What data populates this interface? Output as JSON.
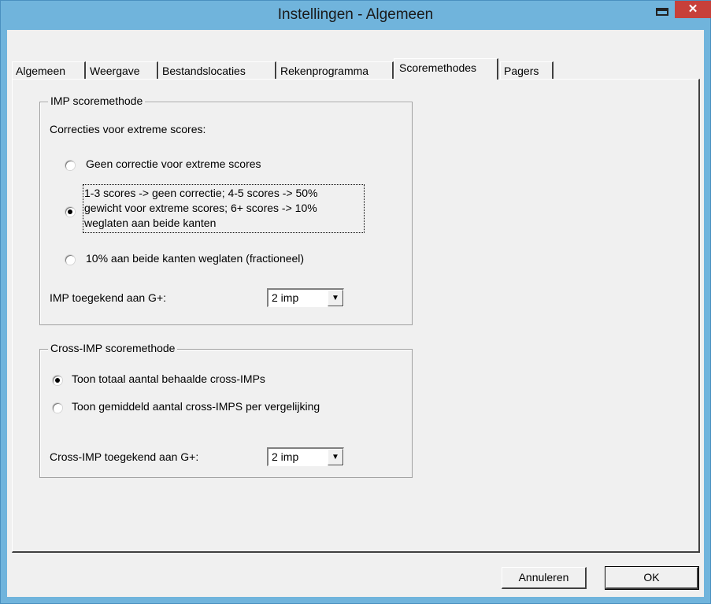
{
  "window": {
    "title": "Instellingen - Algemeen"
  },
  "tabs": [
    {
      "label": "Algemeen"
    },
    {
      "label": "Weergave"
    },
    {
      "label": "Bestandslocaties"
    },
    {
      "label": "Rekenprogramma"
    },
    {
      "label": "Scoremethodes",
      "active": true
    },
    {
      "label": "Pagers"
    }
  ],
  "imp_group": {
    "legend": "IMP scoremethode",
    "intro": "Correcties voor extreme scores:",
    "options": [
      {
        "label": "Geen correctie voor extreme scores",
        "checked": false
      },
      {
        "label_lines": [
          "1-3 scores -> geen correctie; 4-5 scores -> 50%",
          "gewicht voor extreme scores; 6+ scores -> 10%",
          "weglaten aan beide kanten"
        ],
        "checked": true
      },
      {
        "label": "10% aan beide kanten weglaten (fractioneel)",
        "checked": false
      }
    ],
    "gplus_label": "IMP toegekend aan G+:",
    "gplus_value": "2 imp"
  },
  "cross_group": {
    "legend": "Cross-IMP scoremethode",
    "options": [
      {
        "label": "Toon totaal aantal behaalde cross-IMPs",
        "checked": true
      },
      {
        "label": "Toon gemiddeld aantal cross-IMPS per vergelijking",
        "checked": false
      }
    ],
    "gplus_label": "Cross-IMP toegekend aan G+:",
    "gplus_value": "2 imp"
  },
  "buttons": {
    "cancel": "Annuleren",
    "ok": "OK"
  },
  "icons": {
    "minimize": "window-restore-icon",
    "close": "close-icon",
    "dropdown": "chevron-down-icon"
  },
  "colors": {
    "titlebar": "#70b4dc",
    "close": "#c7403a",
    "face": "#f0f0f0"
  }
}
